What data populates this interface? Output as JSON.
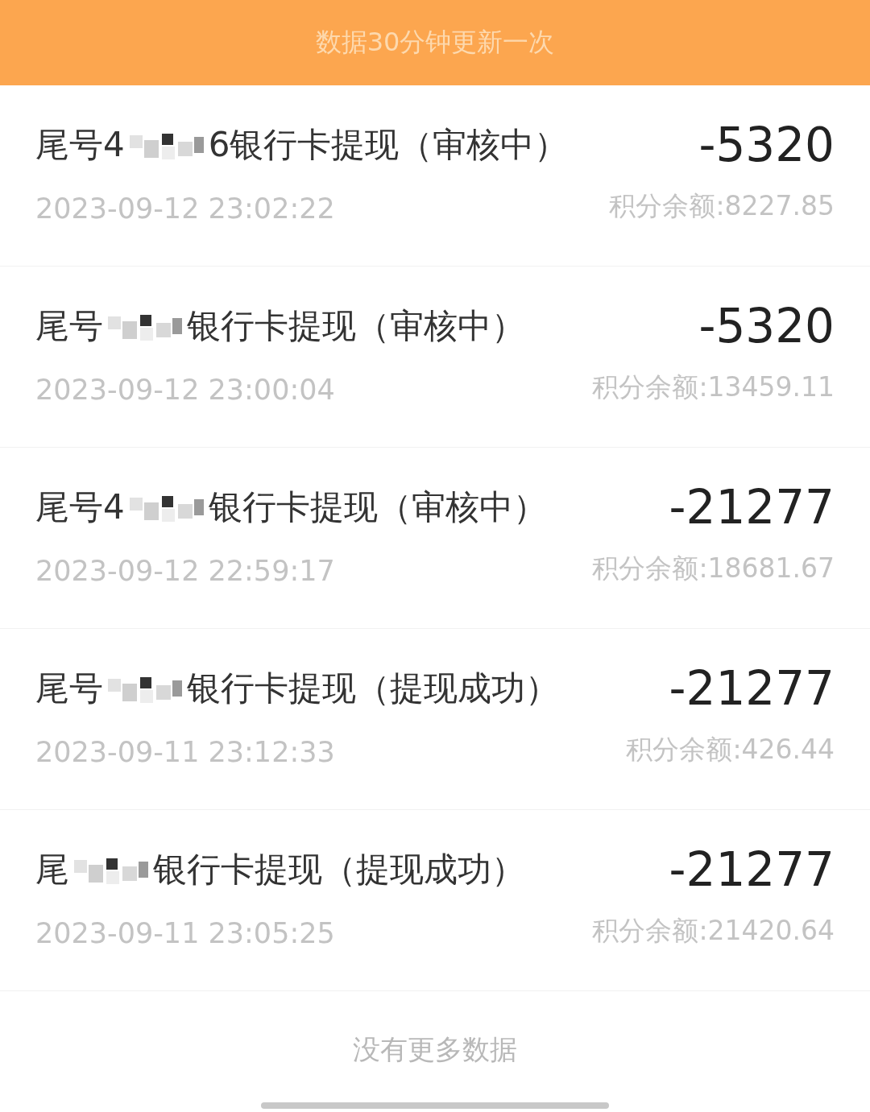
{
  "banner": {
    "text": "数据30分钟更新一次"
  },
  "records": [
    {
      "title_prefix": "尾号4",
      "title_suffix": "6银行卡提现（审核中）",
      "amount": "-5320",
      "time": "2023-09-12 23:02:22",
      "balance": "积分余额:8227.85"
    },
    {
      "title_prefix": "尾号",
      "title_suffix": "银行卡提现（审核中）",
      "amount": "-5320",
      "time": "2023-09-12 23:00:04",
      "balance": "积分余额:13459.11"
    },
    {
      "title_prefix": "尾号4",
      "title_suffix": "银行卡提现（审核中）",
      "amount": "-21277",
      "time": "2023-09-12 22:59:17",
      "balance": "积分余额:18681.67"
    },
    {
      "title_prefix": "尾号",
      "title_suffix": "银行卡提现（提现成功）",
      "amount": "-21277",
      "time": "2023-09-11 23:12:33",
      "balance": "积分余额:426.44"
    },
    {
      "title_prefix": "尾",
      "title_suffix": "银行卡提现（提现成功）",
      "amount": "-21277",
      "time": "2023-09-11 23:05:25",
      "balance": "积分余额:21420.64"
    }
  ],
  "footer": {
    "text": "没有更多数据"
  }
}
